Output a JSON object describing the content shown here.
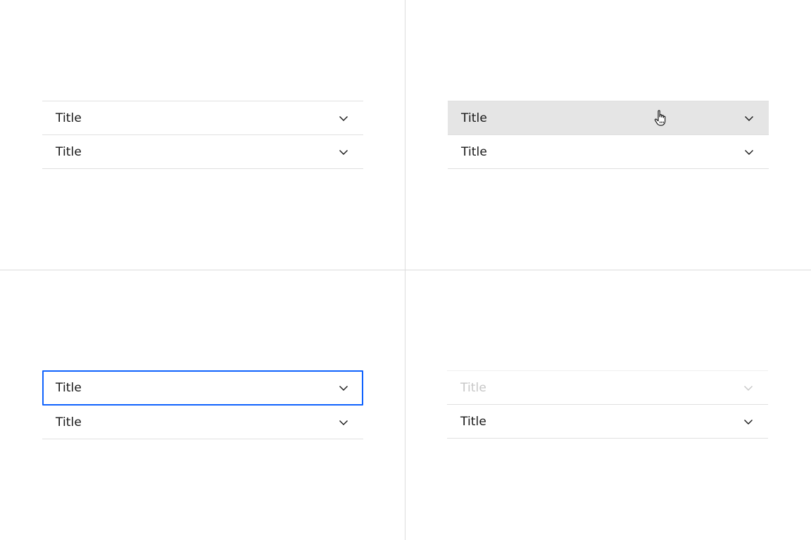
{
  "states": {
    "default": {
      "items": [
        {
          "title": "Title",
          "icon": "chevron-down-icon"
        },
        {
          "title": "Title",
          "icon": "chevron-down-icon"
        }
      ]
    },
    "hover": {
      "items": [
        {
          "title": "Title",
          "icon": "chevron-down-icon"
        },
        {
          "title": "Title",
          "icon": "chevron-down-icon"
        }
      ],
      "cursor_icon": "hand-pointer-icon"
    },
    "focus": {
      "items": [
        {
          "title": "Title",
          "icon": "chevron-down-icon"
        },
        {
          "title": "Title",
          "icon": "chevron-down-icon"
        }
      ]
    },
    "disabled": {
      "items": [
        {
          "title": "Title",
          "icon": "chevron-down-icon"
        },
        {
          "title": "Title",
          "icon": "chevron-down-icon"
        }
      ]
    }
  },
  "colors": {
    "text": "#161616",
    "divider": "#e0e0e0",
    "hover_background": "#e5e5e5",
    "focus_border": "#0f62fe",
    "disabled_text": "#c6c6c6"
  }
}
